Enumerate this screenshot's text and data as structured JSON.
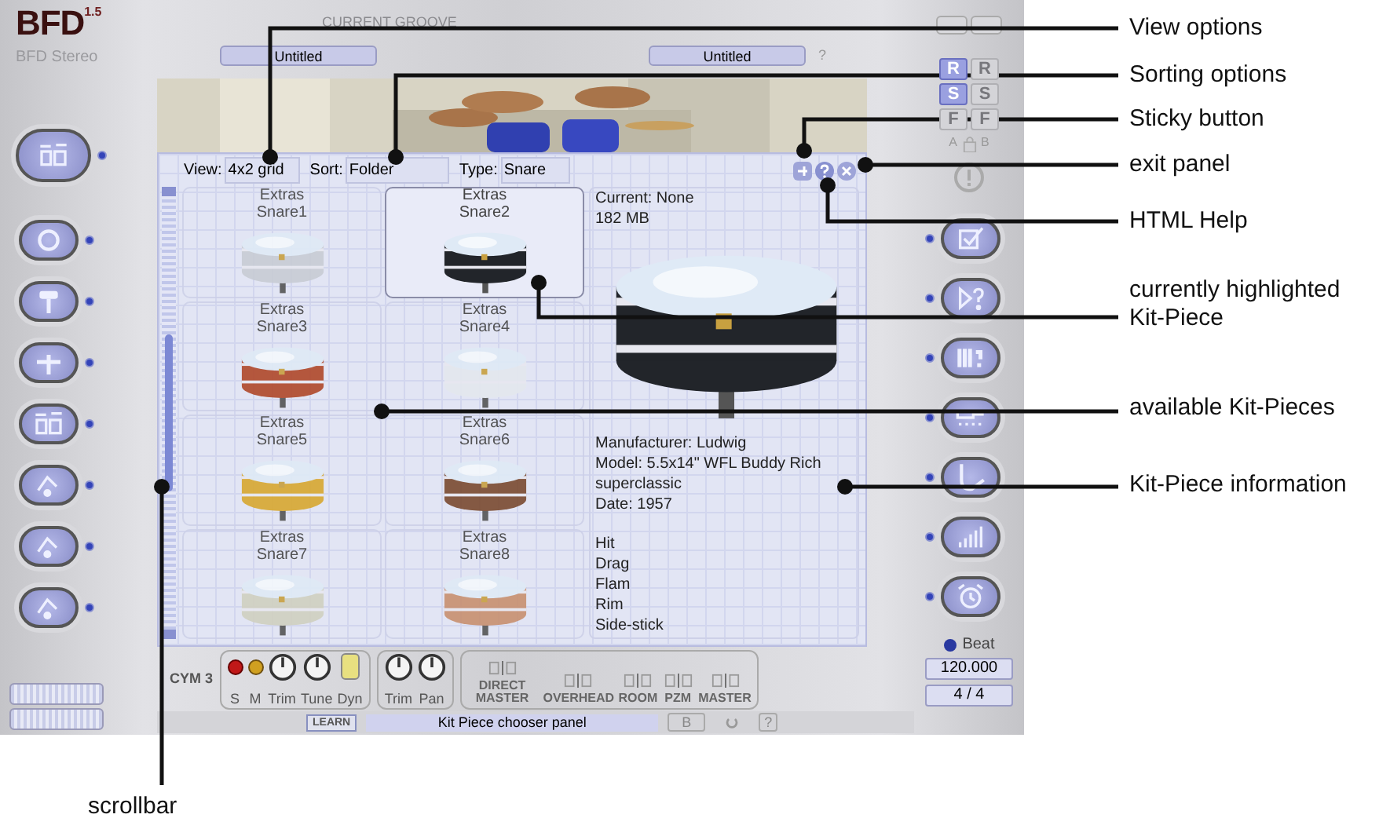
{
  "app": {
    "logo": "BFD",
    "version": "1.5",
    "preset": "BFD Stereo",
    "groove_label": "CURRENT GROOVE",
    "groove_fields": [
      "Untitled",
      "Untitled"
    ],
    "groove_help": "?"
  },
  "panel": {
    "view": {
      "label": "View:",
      "value": "4x2 grid"
    },
    "sort": {
      "label": "Sort:",
      "value": "Folder"
    },
    "type": {
      "label": "Type:",
      "value": "Snare"
    },
    "pieces": [
      {
        "folder": "Extras",
        "name": "Snare1",
        "selected": false
      },
      {
        "folder": "Extras",
        "name": "Snare2",
        "selected": true
      },
      {
        "folder": "Extras",
        "name": "Snare3",
        "selected": false
      },
      {
        "folder": "Extras",
        "name": "Snare4",
        "selected": false
      },
      {
        "folder": "Extras",
        "name": "Snare5",
        "selected": false
      },
      {
        "folder": "Extras",
        "name": "Snare6",
        "selected": false
      },
      {
        "folder": "Extras",
        "name": "Snare7",
        "selected": false
      },
      {
        "folder": "Extras",
        "name": "Snare8",
        "selected": false
      }
    ],
    "info": {
      "current": "Current: None",
      "size": "182 MB",
      "details": [
        "Manufacturer: Ludwig",
        "Model: 5.5x14\" WFL Buddy Rich",
        "superclassic",
        "Date: 1957"
      ],
      "articulations": [
        "Hit",
        "Drag",
        "Flam",
        "Rim",
        "Side-stick"
      ]
    }
  },
  "mixer": {
    "channel": "CYM 3",
    "controls": [
      {
        "label": "S",
        "kind": "solo"
      },
      {
        "label": "M",
        "kind": "mute"
      },
      {
        "label": "Trim",
        "kind": "knob"
      },
      {
        "label": "Tune",
        "kind": "knob"
      },
      {
        "label": "Dyn",
        "kind": "switch",
        "on": true
      }
    ],
    "send_controls": [
      {
        "label": "Trim",
        "kind": "knob"
      },
      {
        "label": "Pan",
        "kind": "knob"
      }
    ],
    "mics": [
      "DIRECT MASTER",
      "OVERHEAD",
      "ROOM",
      "PZM",
      "MASTER"
    ]
  },
  "status_bar": {
    "learn": "LEARN",
    "message": "Kit Piece chooser panel",
    "b": "B",
    "help": "?"
  },
  "right_panel": {
    "slots": [
      {
        "label": "R",
        "selected": true
      },
      {
        "label": "R",
        "selected": false
      },
      {
        "label": "S",
        "selected": true
      },
      {
        "label": "S",
        "selected": false
      },
      {
        "label": "F",
        "selected": false
      },
      {
        "label": "F",
        "selected": false
      }
    ],
    "lock_a": "A",
    "lock_b": "B",
    "beat": "Beat",
    "tempo": "120.000",
    "signature": "4 / 4"
  },
  "annotations": [
    {
      "label": "View options"
    },
    {
      "label": "Sorting options"
    },
    {
      "label": "Sticky button"
    },
    {
      "label": "exit panel"
    },
    {
      "label": "HTML Help"
    },
    {
      "label": "currently highlighted Kit-Piece"
    },
    {
      "label": "available Kit-Pieces"
    },
    {
      "label": "Kit-Piece information"
    }
  ],
  "scrollbar_label": "scrollbar"
}
